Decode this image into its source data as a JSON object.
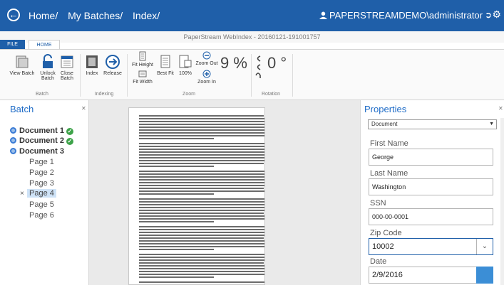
{
  "topbar": {
    "breadcrumbs": [
      "Home/",
      "My Batches/",
      "Index/"
    ],
    "user": "PAPERSTREAMDEMO\\administrator"
  },
  "ribbon": {
    "title": "PaperStream WebIndex - 20160121-191001757",
    "tabs": [
      "FILE",
      "HOME"
    ],
    "batch_buttons": [
      {
        "label": "View Batch",
        "icon": "view-batch-icon"
      },
      {
        "label": "Unlock Batch",
        "icon": "unlock-icon"
      },
      {
        "label": "Close Batch",
        "icon": "calendar-icon"
      }
    ],
    "indexing_buttons": [
      {
        "label": "Index",
        "icon": "index-icon"
      },
      {
        "label": "Release",
        "icon": "release-icon"
      }
    ],
    "zoom_buttons": {
      "fit_height": "Fit Height",
      "fit_width": "Fit Width",
      "best_fit": "Best Fit",
      "hundred": "100%",
      "zoom_out": "Zoom Out",
      "zoom_in": "Zoom In"
    },
    "zoom_value": "9 %",
    "rotation_value": "0 °",
    "groups": [
      "Batch",
      "Indexing",
      "Zoom",
      "Rotation"
    ]
  },
  "batch_panel": {
    "title": "Batch",
    "documents": [
      {
        "label": "Document 1",
        "checked": true
      },
      {
        "label": "Document 2",
        "checked": true
      },
      {
        "label": "Document 3",
        "checked": false
      }
    ],
    "pages": [
      "Page 1",
      "Page 2",
      "Page 3",
      "Page 4",
      "Page 5",
      "Page 6"
    ],
    "selected_page": "Page 4"
  },
  "properties": {
    "title": "Properties",
    "doc_type": "Document",
    "fields": [
      {
        "label": "First Name",
        "value": "George"
      },
      {
        "label": "Last Name",
        "value": "Washington"
      },
      {
        "label": "SSN",
        "value": "000-00-0001"
      },
      {
        "label": "Zip Code",
        "value": "10002"
      },
      {
        "label": "Date",
        "value": "2/9/2016"
      }
    ]
  },
  "colors": {
    "accent": "#1f5fa9",
    "ok": "#3ea34a",
    "selection": "#cfe3f7"
  }
}
